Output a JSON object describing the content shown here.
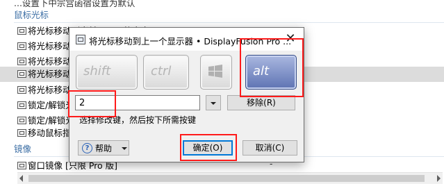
{
  "background": {
    "top_partial_text": "...设置下中宗宫函宿设置为默认",
    "groups": [
      {
        "label": "鼠标光标"
      },
      {
        "label": "镜像"
      }
    ],
    "rows": [
      {
        "label": "将光标移动到当前显示器的中央"
      },
      {
        "label": "将光标移动到下一个显示器"
      },
      {
        "label": "将光标移动到上一个显示器"
      },
      {
        "label": "将光标移动到当前显示器"
      },
      {
        "label": "将光标移动到主显示器"
      },
      {
        "label": "锁定/解锁光标"
      },
      {
        "label": "锁定/解锁光标到当前显示器"
      },
      {
        "label": "移动鼠标指针"
      }
    ],
    "mirror_row": {
      "label": "窗口镜像 [只限 Pro 版]",
      "value": "-"
    }
  },
  "dialog": {
    "title": "将光标移动到上一个显示器 • DisplayFusion Pro ...",
    "keys": {
      "shift": "shift",
      "ctrl": "ctrl",
      "alt": "alt",
      "win_icon": "windows-logo-icon"
    },
    "hotkey_value": "2",
    "remove_label": "移除(R)",
    "hint": "选择修改键，然后按下所需按键",
    "help_label": "帮助",
    "ok_label": "确定(O)",
    "cancel_label": "取消(C)",
    "active_key": "alt"
  },
  "colors": {
    "annotation_red": "#ff1a1a",
    "group_blue": "#3d6fa5",
    "alt_key": "#6a7fbf",
    "focus_blue": "#0078d7"
  }
}
